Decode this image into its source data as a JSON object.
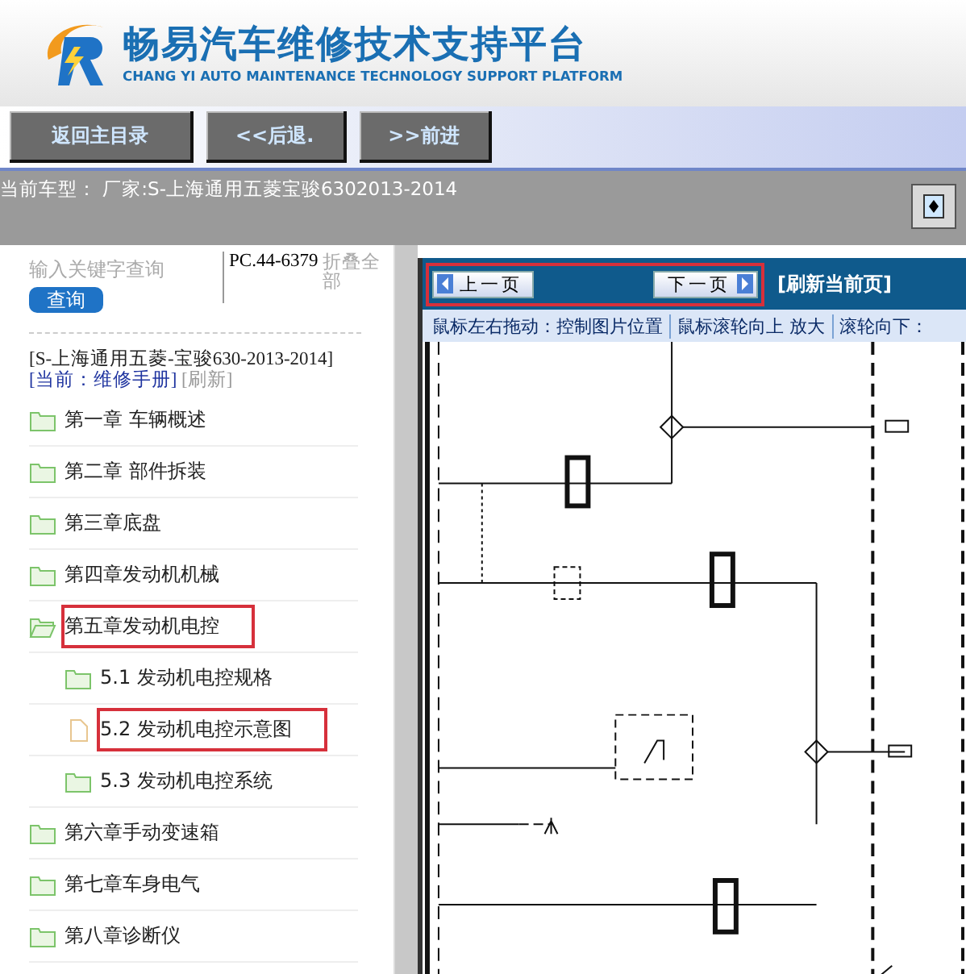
{
  "header": {
    "title": "畅易汽车维修技术支持平台",
    "subtitle": "CHANG YI AUTO MAINTENANCE TECHNOLOGY SUPPORT PLATFORM"
  },
  "nav_buttons": [
    "返回主目录",
    "<<后退.",
    ">>前进"
  ],
  "model_bar": {
    "text": "当前车型：  厂家:S-上海通用五菱宝骏6302013-2014"
  },
  "sidebar": {
    "search": {
      "placeholder": "输入关键字查询",
      "button": "查询"
    },
    "code": "PC.44-6379",
    "collapse_link": "折叠全部",
    "vehicle": "[S-上海通用五菱-宝骏630-2013-2014]",
    "current": "[当前：维修手册]",
    "refresh": "[刷新]",
    "tree": [
      {
        "kind": "folder",
        "label": "第一章 车辆概述",
        "expanded": false,
        "highlighted": false
      },
      {
        "kind": "folder",
        "label": "第二章 部件拆装",
        "expanded": false,
        "highlighted": false
      },
      {
        "kind": "folder",
        "label": "第三章底盘",
        "expanded": false,
        "highlighted": false
      },
      {
        "kind": "folder",
        "label": "第四章发动机机械",
        "expanded": false,
        "highlighted": false
      },
      {
        "kind": "folder",
        "label": "第五章发动机电控",
        "expanded": true,
        "highlighted": true,
        "children": [
          {
            "kind": "folder",
            "label": "5.1 发动机电控规格",
            "expanded": false,
            "highlighted": false
          },
          {
            "kind": "file",
            "label": "5.2 发动机电控示意图",
            "highlighted": true
          },
          {
            "kind": "folder",
            "label": "5.3 发动机电控系统",
            "expanded": false,
            "highlighted": false
          }
        ]
      },
      {
        "kind": "folder",
        "label": "第六章手动变速箱",
        "expanded": false,
        "highlighted": false
      },
      {
        "kind": "folder",
        "label": "第七章车身电气",
        "expanded": false,
        "highlighted": false
      },
      {
        "kind": "folder",
        "label": "第八章诊断仪",
        "expanded": false,
        "highlighted": false
      }
    ]
  },
  "viewer": {
    "pager": {
      "highlighted": true,
      "prev": "上一页",
      "next": "下一页"
    },
    "refresh": "[刷新当前页]",
    "hints": [
      "鼠标左右拖动：控制图片位置",
      "鼠标滚轮向上 放大",
      "滚轮向下："
    ]
  }
}
